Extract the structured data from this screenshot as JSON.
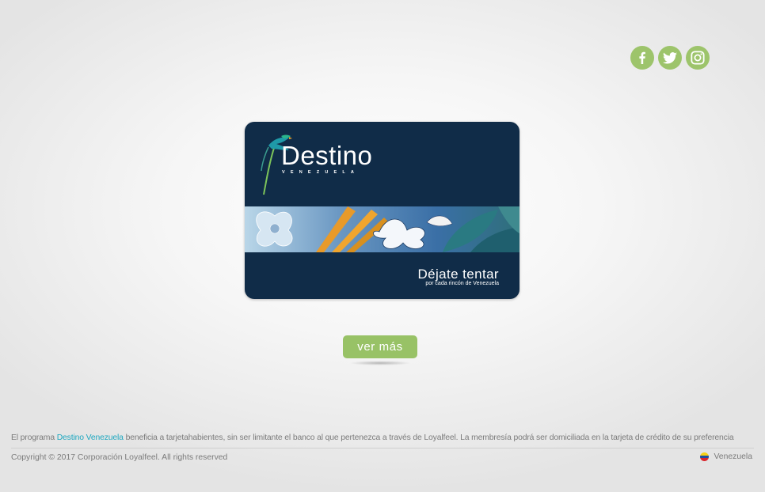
{
  "social": {
    "facebook_icon": "facebook-icon",
    "twitter_icon": "twitter-icon",
    "instagram_icon": "instagram-icon",
    "color": "#9dc46b"
  },
  "card": {
    "title": "Destino",
    "subtitle": "VENEZUELA",
    "slogan": "Déjate tentar",
    "slogan_sub": "por cada rincón de Venezuela",
    "background_color": "#102c48"
  },
  "cta": {
    "label": "ver más",
    "color": "#98c266"
  },
  "footer": {
    "intro_prefix": "El programa",
    "intro_link": "Destino Venezuela",
    "intro_suffix": "beneficia a tarjetahabientes, sin ser limitante el banco al que pertenezca a través de Loyalfeel. La membresía podrá ser domiciliada en la tarjeta de crédito de su preferencia",
    "copyright": "Copyright © 2017 Corporación Loyalfeel. All rights reserved",
    "country": "Venezuela",
    "flag_icon": "venezuela-flag-icon",
    "link_color": "#1fa8c0"
  }
}
